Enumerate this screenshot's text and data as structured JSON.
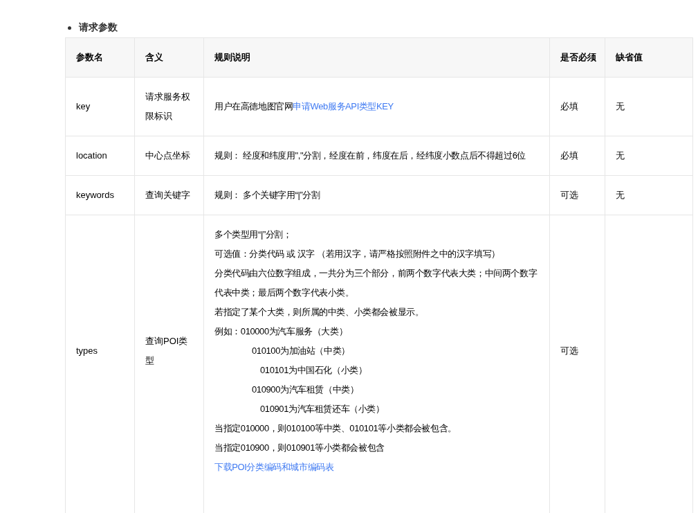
{
  "section": {
    "title": "请求参数"
  },
  "table": {
    "columns": [
      "参数名",
      "含义",
      "规则说明",
      "是否必须",
      "缺省值"
    ],
    "rows": [
      {
        "name": "key",
        "meaning": "请求服务权限标识",
        "rules": [
          {
            "kind": "plain",
            "text": "用户在高德地图官网",
            "link_text": "申请Web服务API类型KEY"
          }
        ],
        "required": "必填",
        "default": "无"
      },
      {
        "name": "location",
        "meaning": "中心点坐标",
        "rules": [
          {
            "kind": "plain",
            "text": "规则： 经度和纬度用\",\"分割，经度在前，纬度在后，经纬度小数点后不得超过6位"
          }
        ],
        "required": "必填",
        "default": "无"
      },
      {
        "name": "keywords",
        "meaning": "查询关键字",
        "rules": [
          {
            "kind": "plain",
            "text": "规则： 多个关键字用“|”分割"
          }
        ],
        "required": "可选",
        "default": "无"
      },
      {
        "name": "types",
        "meaning": "查询POI类型",
        "rules": [
          {
            "kind": "plain",
            "text": "多个类型用“|”分割；"
          },
          {
            "kind": "plain",
            "text": "可选值：分类代码 或 汉字 （若用汉字，请严格按照附件之中的汉字填写）"
          },
          {
            "kind": "plain",
            "text": "分类代码由六位数字组成，一共分为三个部分，前两个数字代表大类；中间两个数字代表中类；最后两个数字代表小类。"
          },
          {
            "kind": "plain",
            "text": "若指定了某个大类，则所属的中类、小类都会被显示。"
          },
          {
            "kind": "plain",
            "text": "例如：010000为汽车服务（大类）"
          },
          {
            "kind": "indent1",
            "text": "010100为加油站（中类）"
          },
          {
            "kind": "indent2",
            "text": "010101为中国石化（小类）"
          },
          {
            "kind": "indent1",
            "text": "010900为汽车租赁（中类）"
          },
          {
            "kind": "indent2",
            "text": "010901为汽车租赁还车（小类）"
          },
          {
            "kind": "plain",
            "text": "当指定010000，则010100等中类、010101等小类都会被包含。"
          },
          {
            "kind": "plain",
            "text": "当指定010900，则010901等小类都会被包含"
          },
          {
            "kind": "link",
            "text": "下载POI分类编码和城市编码表"
          }
        ],
        "required": "可选"
      }
    ]
  }
}
